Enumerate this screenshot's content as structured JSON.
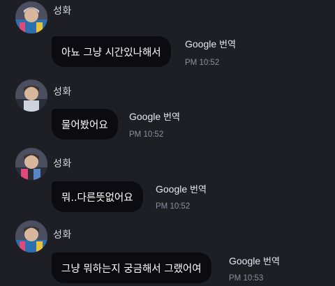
{
  "messages": [
    {
      "sender": "성화",
      "text": "아뇨 그냥 시간있나해서",
      "translate": "Google",
      "translate_ko": "번역",
      "time": "PM 10:52"
    },
    {
      "sender": "성화",
      "text": "물어봤어요",
      "translate": "Google",
      "translate_ko": "번역",
      "time": "PM 10:52"
    },
    {
      "sender": "성화",
      "text": "뭐..다른뜻없어요",
      "translate": "Google",
      "translate_ko": "번역",
      "time": "PM 10:52"
    },
    {
      "sender": "성화",
      "text": "그냥 뭐하는지 궁금해서 그랬어여",
      "translate": "Google",
      "translate_ko": "번역",
      "time": "PM 10:53"
    }
  ],
  "colors": {
    "background": "#1e1f25",
    "bubble": "#0c0c10",
    "timestamp": "#8e8f9c"
  }
}
